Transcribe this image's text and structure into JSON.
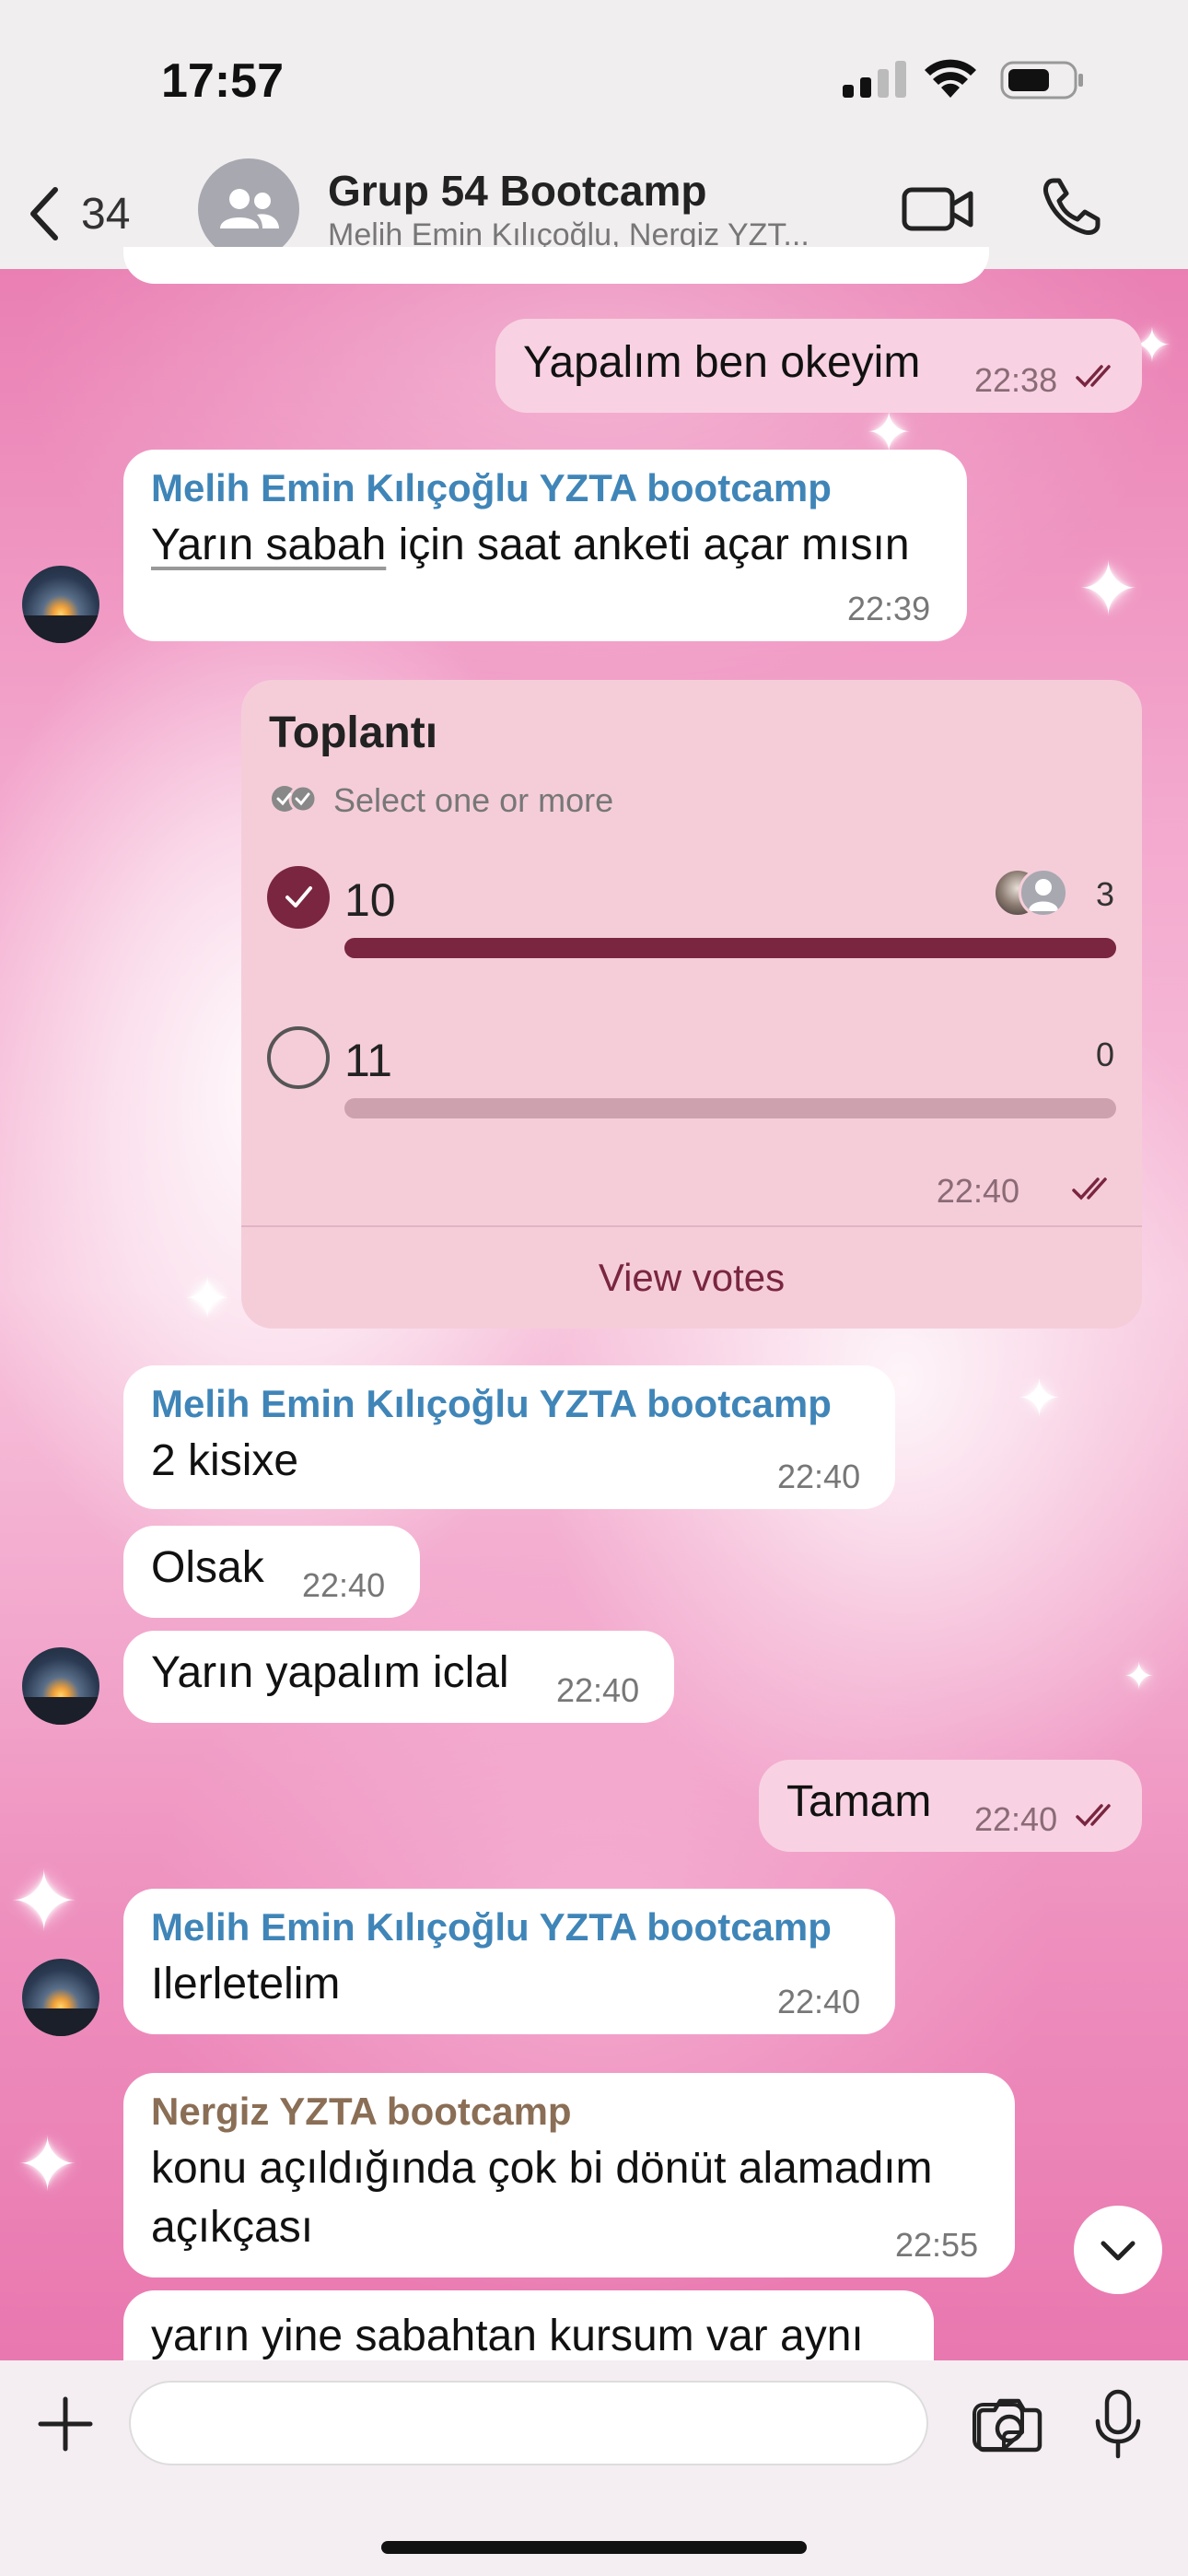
{
  "status_bar": {
    "time": "17:57"
  },
  "header": {
    "back_count": "34",
    "title": "Grup 54 Bootcamp",
    "subtitle": "Melih Emin Kılıçoğlu, Nergiz YZT..."
  },
  "messages": {
    "m1": {
      "text": "Yapalım ben okeyim",
      "time": "22:38"
    },
    "m2": {
      "sender": "Melih Emin Kılıçoğlu YZTA bootcamp",
      "text_underlined": "Yarın sabah",
      "text_rest": " için saat anketi açar mısın",
      "time": "22:39"
    },
    "m3": {
      "sender": "Melih Emin Kılıçoğlu YZTA bootcamp",
      "text": "2 kisixe",
      "time": "22:40"
    },
    "m4": {
      "text": "Olsak",
      "time": "22:40"
    },
    "m5": {
      "text": "Yarın yapalım iclal",
      "time": "22:40"
    },
    "m6": {
      "text": "Tamam",
      "time": "22:40"
    },
    "m7": {
      "sender": "Melih Emin Kılıçoğlu YZTA bootcamp",
      "text": "Ilerletelim",
      "time": "22:40"
    },
    "m8": {
      "sender": "Nergiz YZTA bootcamp",
      "line1": "konu açıldığında çok bi dönüt alamadım",
      "line2": "açıkçası",
      "time": "22:55"
    },
    "m9": {
      "text": "yarın yine sabahtan kursum var aynı"
    }
  },
  "poll": {
    "title": "Toplantı",
    "mode": "Select one or more",
    "options": [
      {
        "label": "10",
        "votes": "3",
        "selected": true,
        "fraction": 1.0
      },
      {
        "label": "11",
        "votes": "0",
        "selected": false,
        "fraction": 0.0
      }
    ],
    "time": "22:40",
    "view_votes": "View votes"
  },
  "colors": {
    "accent": "#7a2640",
    "sender_blue": "#3f85b8",
    "sender_brown": "#8a6e55",
    "outgoing_bubble": "#f8d2e2",
    "incoming_bubble": "#ffffff"
  },
  "icons": {
    "back": "chevron-left-icon",
    "group": "group-avatar-icon",
    "video": "video-camera-icon",
    "call": "phone-icon",
    "plus": "plus-icon",
    "sticker": "sticker-icon",
    "camera": "camera-icon",
    "mic": "microphone-icon",
    "scroll": "chevron-down-icon"
  }
}
